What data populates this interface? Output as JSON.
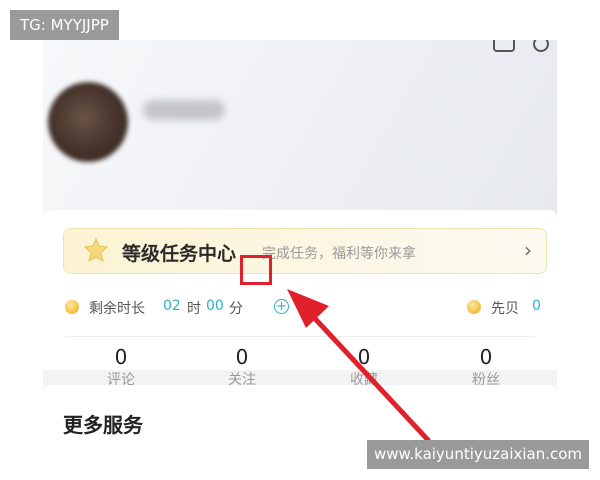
{
  "watermark_top": "TG: MYYJJPP",
  "watermark_bottom": "www.kaiyuntiyuzaixian.com",
  "header": {
    "icons": [
      "bell-icon",
      "gear-icon"
    ]
  },
  "level_banner": {
    "title": "等级任务中心",
    "subtitle": "完成任务，福利等你来拿",
    "chevron": "›"
  },
  "time_row": {
    "label": "剩余时长",
    "hours": "02",
    "hours_unit": "时",
    "minutes": "00",
    "minutes_unit": "分",
    "add_symbol": "+"
  },
  "xianbei": {
    "label": "先贝",
    "value": "0"
  },
  "stats": [
    {
      "value": "0",
      "label": "评论"
    },
    {
      "value": "0",
      "label": "关注"
    },
    {
      "value": "0",
      "label": "收藏"
    },
    {
      "value": "0",
      "label": "粉丝"
    }
  ],
  "more_services": {
    "title": "更多服务"
  },
  "colors": {
    "accent": "#2bb2c9",
    "highlight": "#e0202a",
    "arrow": "#e0202a",
    "tag_bg": "#9a9a9a"
  }
}
